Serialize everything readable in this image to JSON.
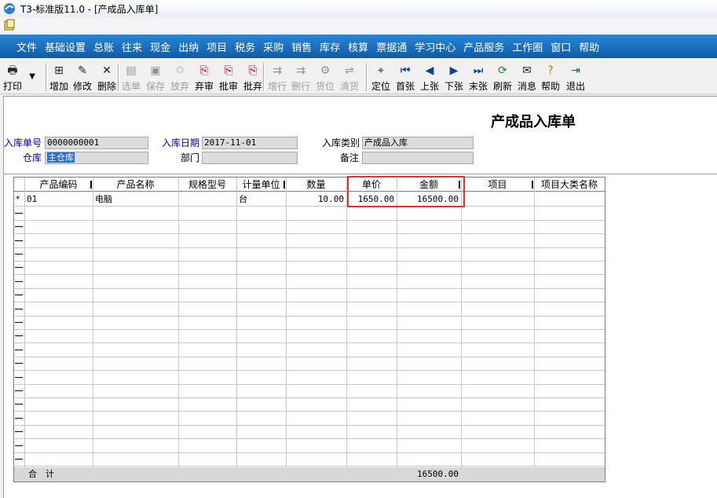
{
  "window": {
    "title": "T3-标准版11.0 - [产成品入库单]"
  },
  "menu": [
    "文件",
    "基础设置",
    "总账",
    "往来",
    "现金",
    "出纳",
    "项目",
    "税务",
    "采购",
    "销售",
    "库存",
    "核算",
    "票据通",
    "学习中心",
    "产品服务",
    "工作圈",
    "窗口",
    "帮助"
  ],
  "toolbar": [
    {
      "label": "打印",
      "icon": "printer-icon",
      "glyph": "🖶",
      "enabled": true
    },
    {
      "label": "增加",
      "icon": "add-document-icon",
      "glyph": "⊞",
      "enabled": true
    },
    {
      "label": "修改",
      "icon": "edit-icon",
      "glyph": "✎",
      "enabled": true
    },
    {
      "label": "删除",
      "icon": "delete-icon",
      "glyph": "✕",
      "enabled": true
    },
    {
      "label": "选单",
      "icon": "select-document-icon",
      "glyph": "▤",
      "enabled": false
    },
    {
      "label": "保存",
      "icon": "save-icon",
      "glyph": "▣",
      "enabled": false
    },
    {
      "label": "放弃",
      "icon": "discard-icon",
      "glyph": "♲",
      "enabled": false
    },
    {
      "label": "弃审",
      "icon": "unapprove-icon",
      "glyph": "⎘",
      "enabled": true
    },
    {
      "label": "批审",
      "icon": "batch-approve-icon",
      "glyph": "⎘",
      "enabled": true
    },
    {
      "label": "批弃",
      "icon": "batch-unapprove-icon",
      "glyph": "⎘",
      "enabled": true
    },
    {
      "label": "增行",
      "icon": "add-row-icon",
      "glyph": "⇉",
      "enabled": false
    },
    {
      "label": "删行",
      "icon": "delete-row-icon",
      "glyph": "⇉",
      "enabled": false
    },
    {
      "label": "货位",
      "icon": "location-icon",
      "glyph": "⚙",
      "enabled": false
    },
    {
      "label": "清货",
      "icon": "clear-goods-icon",
      "glyph": "⇌",
      "enabled": false
    },
    {
      "label": "定位",
      "icon": "locate-icon",
      "glyph": "⌖",
      "enabled": true
    },
    {
      "label": "首张",
      "icon": "first-record-icon",
      "glyph": "⏮",
      "enabled": true
    },
    {
      "label": "上张",
      "icon": "previous-record-icon",
      "glyph": "◀",
      "enabled": true
    },
    {
      "label": "下张",
      "icon": "next-record-icon",
      "glyph": "▶",
      "enabled": true
    },
    {
      "label": "末张",
      "icon": "last-record-icon",
      "glyph": "⏭",
      "enabled": true
    },
    {
      "label": "刷新",
      "icon": "refresh-icon",
      "glyph": "⟳",
      "enabled": true
    },
    {
      "label": "消息",
      "icon": "message-icon",
      "glyph": "✉",
      "enabled": true
    },
    {
      "label": "帮助",
      "icon": "help-icon",
      "glyph": "?",
      "enabled": true
    },
    {
      "label": "退出",
      "icon": "exit-icon",
      "glyph": "⇥",
      "enabled": true
    }
  ],
  "form": {
    "title": "产成品入库单",
    "fields": {
      "doc_no": {
        "label": "入库单号",
        "value": "0000000001"
      },
      "date": {
        "label": "入库日期",
        "value": "2017-11-01"
      },
      "category": {
        "label": "入库类别",
        "value": "产成品入库"
      },
      "warehouse": {
        "label": "仓库",
        "value": "主仓库"
      },
      "department": {
        "label": "部门",
        "value": ""
      },
      "remark": {
        "label": "备注",
        "value": ""
      }
    }
  },
  "grid": {
    "columns": [
      "产品编码",
      "产品名称",
      "规格型号",
      "计量单位",
      "数量",
      "单价",
      "金额",
      "项目",
      "项目大类名称"
    ],
    "rows": [
      {
        "marker": "*",
        "code": "01",
        "name": "电脑",
        "spec": "",
        "unit": "台",
        "qty": "10.00",
        "price": "1650.00",
        "amount": "16500.00",
        "project": "",
        "project_cat": ""
      }
    ],
    "total_label": "合　计",
    "total_amount": "16500.00"
  },
  "colors": {
    "menubar": "#1a6fc0",
    "highlight": "#e03030",
    "label_blue": "#0000c8"
  }
}
